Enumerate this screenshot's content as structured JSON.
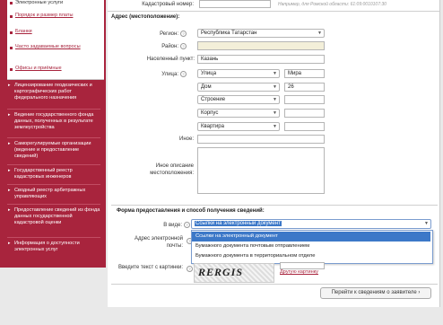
{
  "sidebar": {
    "top_items": [
      {
        "label": "Электронные услуги"
      },
      {
        "label": "Порядок и размер платы"
      },
      {
        "label": "Бланки"
      },
      {
        "label": "Часто задаваемые вопросы"
      },
      {
        "label": "Офисы и приёмные"
      }
    ],
    "red_items": [
      {
        "label": "Лицензирование геодезических и картографических работ федерального назначения"
      },
      {
        "label": "Ведение государственного фонда данных, полученных в результате землеустройства"
      },
      {
        "label": "Саморегулируемые организации (ведение и предоставление сведений)"
      },
      {
        "label": "Государственный реестр кадастровых инженеров"
      },
      {
        "label": "Сводный реестр арбитражных управляющих"
      },
      {
        "label": "Предоставление сведений из фонда данных государственной кадастровой оценки"
      },
      {
        "label": "Информация о доступности электронных услуг"
      }
    ]
  },
  "form": {
    "cadastral_label": "Кадастровый номер:",
    "cadastral_hint": "Например, для Ромской области: 61:09:0010107:30",
    "address_section": "Адрес (местоположение):",
    "region_label": "Регион:",
    "region_value": "Республика Татарстан",
    "district_label": "Район:",
    "locality_label": "Населенный пункт:",
    "locality_value": "Казань",
    "street_label": "Улица:",
    "street_type": "Улица",
    "street_value": "Мира",
    "house_type": "Дом",
    "house_value": "26",
    "building_type": "Строение",
    "korpus_type": "Корпус",
    "flat_type": "Квартира",
    "other_label": "Иное:",
    "other_desc_label": "Иное описание местоположения:",
    "delivery_section": "Форма предоставления и способ получения сведений:",
    "view_label": "В виде:",
    "view_value": "Ссылки на электронный документ",
    "email_label": "Адрес электронной почты:",
    "captcha_label": "Введите текст с картинки:",
    "captcha_text": "RERGIS",
    "captcha_other": "Другую картинку",
    "next_button": "Перейти к сведениям о заявителе"
  },
  "dropdown": {
    "options": [
      {
        "label": "Ссылки на электронный документ"
      },
      {
        "label": "Бумажного документа почтовым отправлением"
      },
      {
        "label": "Бумажного документа в территориальном отделе"
      }
    ]
  }
}
